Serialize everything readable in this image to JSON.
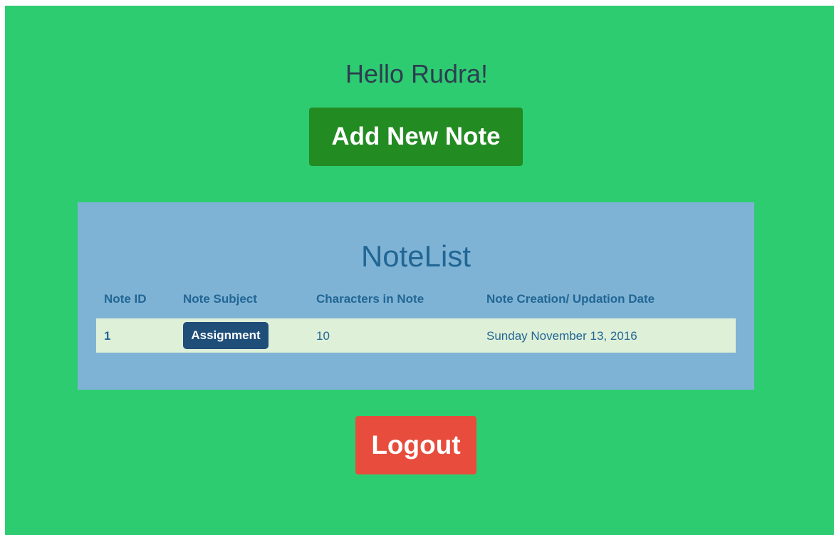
{
  "greeting": "Hello Rudra!",
  "actions": {
    "add_note_label": "Add New Note",
    "logout_label": "Logout"
  },
  "notes": {
    "title": "NoteList",
    "columns": [
      "Note ID",
      "Note Subject",
      "Characters in Note",
      "Note Creation/ Updation Date"
    ],
    "rows": [
      {
        "id": "1",
        "subject": "Assignment",
        "characters": "10",
        "date": "Sunday November 13, 2016"
      }
    ]
  },
  "colors": {
    "page_background": "#2ecc71",
    "panel_background": "#7fb3d5",
    "add_button": "#228b22",
    "logout_button": "#e74c3c",
    "subject_button": "#1f4e79",
    "row_background": "#dff0d8"
  }
}
